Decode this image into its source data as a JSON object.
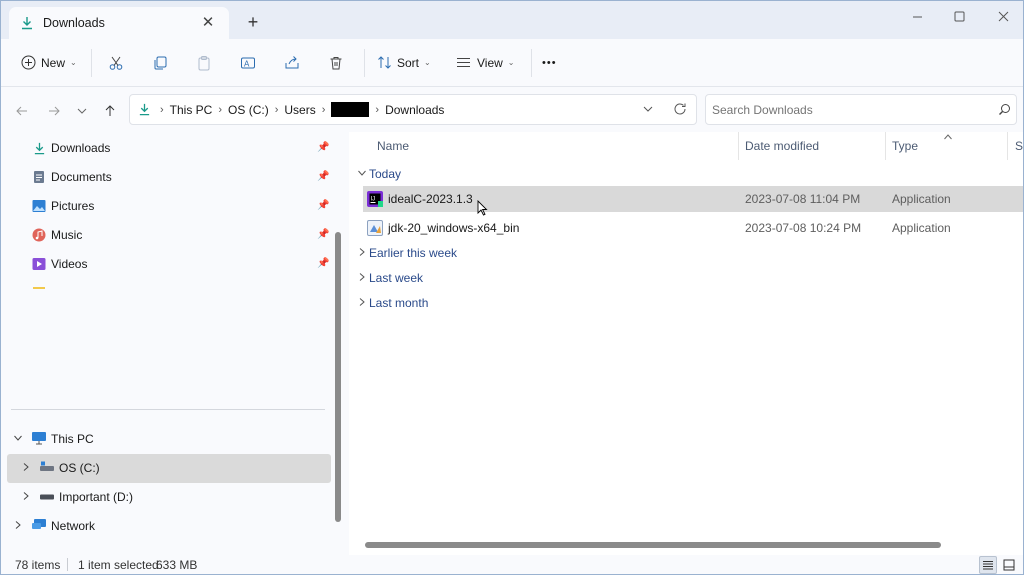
{
  "window": {
    "tab_title": "Downloads",
    "close_glyph": "✕",
    "new_tab_glyph": "+",
    "controls": {
      "minimize": "—",
      "maximize": "☐",
      "close": "✕"
    }
  },
  "toolbar": {
    "new_label": "New",
    "sort_label": "Sort",
    "view_label": "View",
    "more_glyph": "•••"
  },
  "address": {
    "crumbs": [
      "This PC",
      "OS (C:)",
      "Users",
      "Downloads"
    ],
    "search_placeholder": "Search Downloads"
  },
  "sidebar": {
    "quick_access": [
      {
        "label": "Downloads",
        "icon": "download-icon"
      },
      {
        "label": "Documents",
        "icon": "document-icon"
      },
      {
        "label": "Pictures",
        "icon": "pictures-icon"
      },
      {
        "label": "Music",
        "icon": "music-icon"
      },
      {
        "label": "Videos",
        "icon": "videos-icon"
      }
    ],
    "this_pc": "This PC",
    "drives": [
      "OS (C:)",
      "Important (D:)"
    ],
    "network": "Network"
  },
  "content": {
    "columns": {
      "name": "Name",
      "date": "Date modified",
      "type": "Type",
      "size": "Si"
    },
    "groups": {
      "today": "Today",
      "earlier": "Earlier this week",
      "last_week": "Last week",
      "last_month": "Last month"
    },
    "files": [
      {
        "name": "idealC-2023.1.3",
        "date": "2023-07-08 11:04 PM",
        "type": "Application",
        "selected": true
      },
      {
        "name": "jdk-20_windows-x64_bin",
        "date": "2023-07-08 10:24 PM",
        "type": "Application",
        "selected": false
      }
    ]
  },
  "status": {
    "items_count": "78 items",
    "selection": "1 item selected",
    "size": "633 MB"
  },
  "colors": {
    "accent": "#2a9d8f",
    "group_text": "#2a4a8a",
    "selection": "#d9d9d9"
  }
}
